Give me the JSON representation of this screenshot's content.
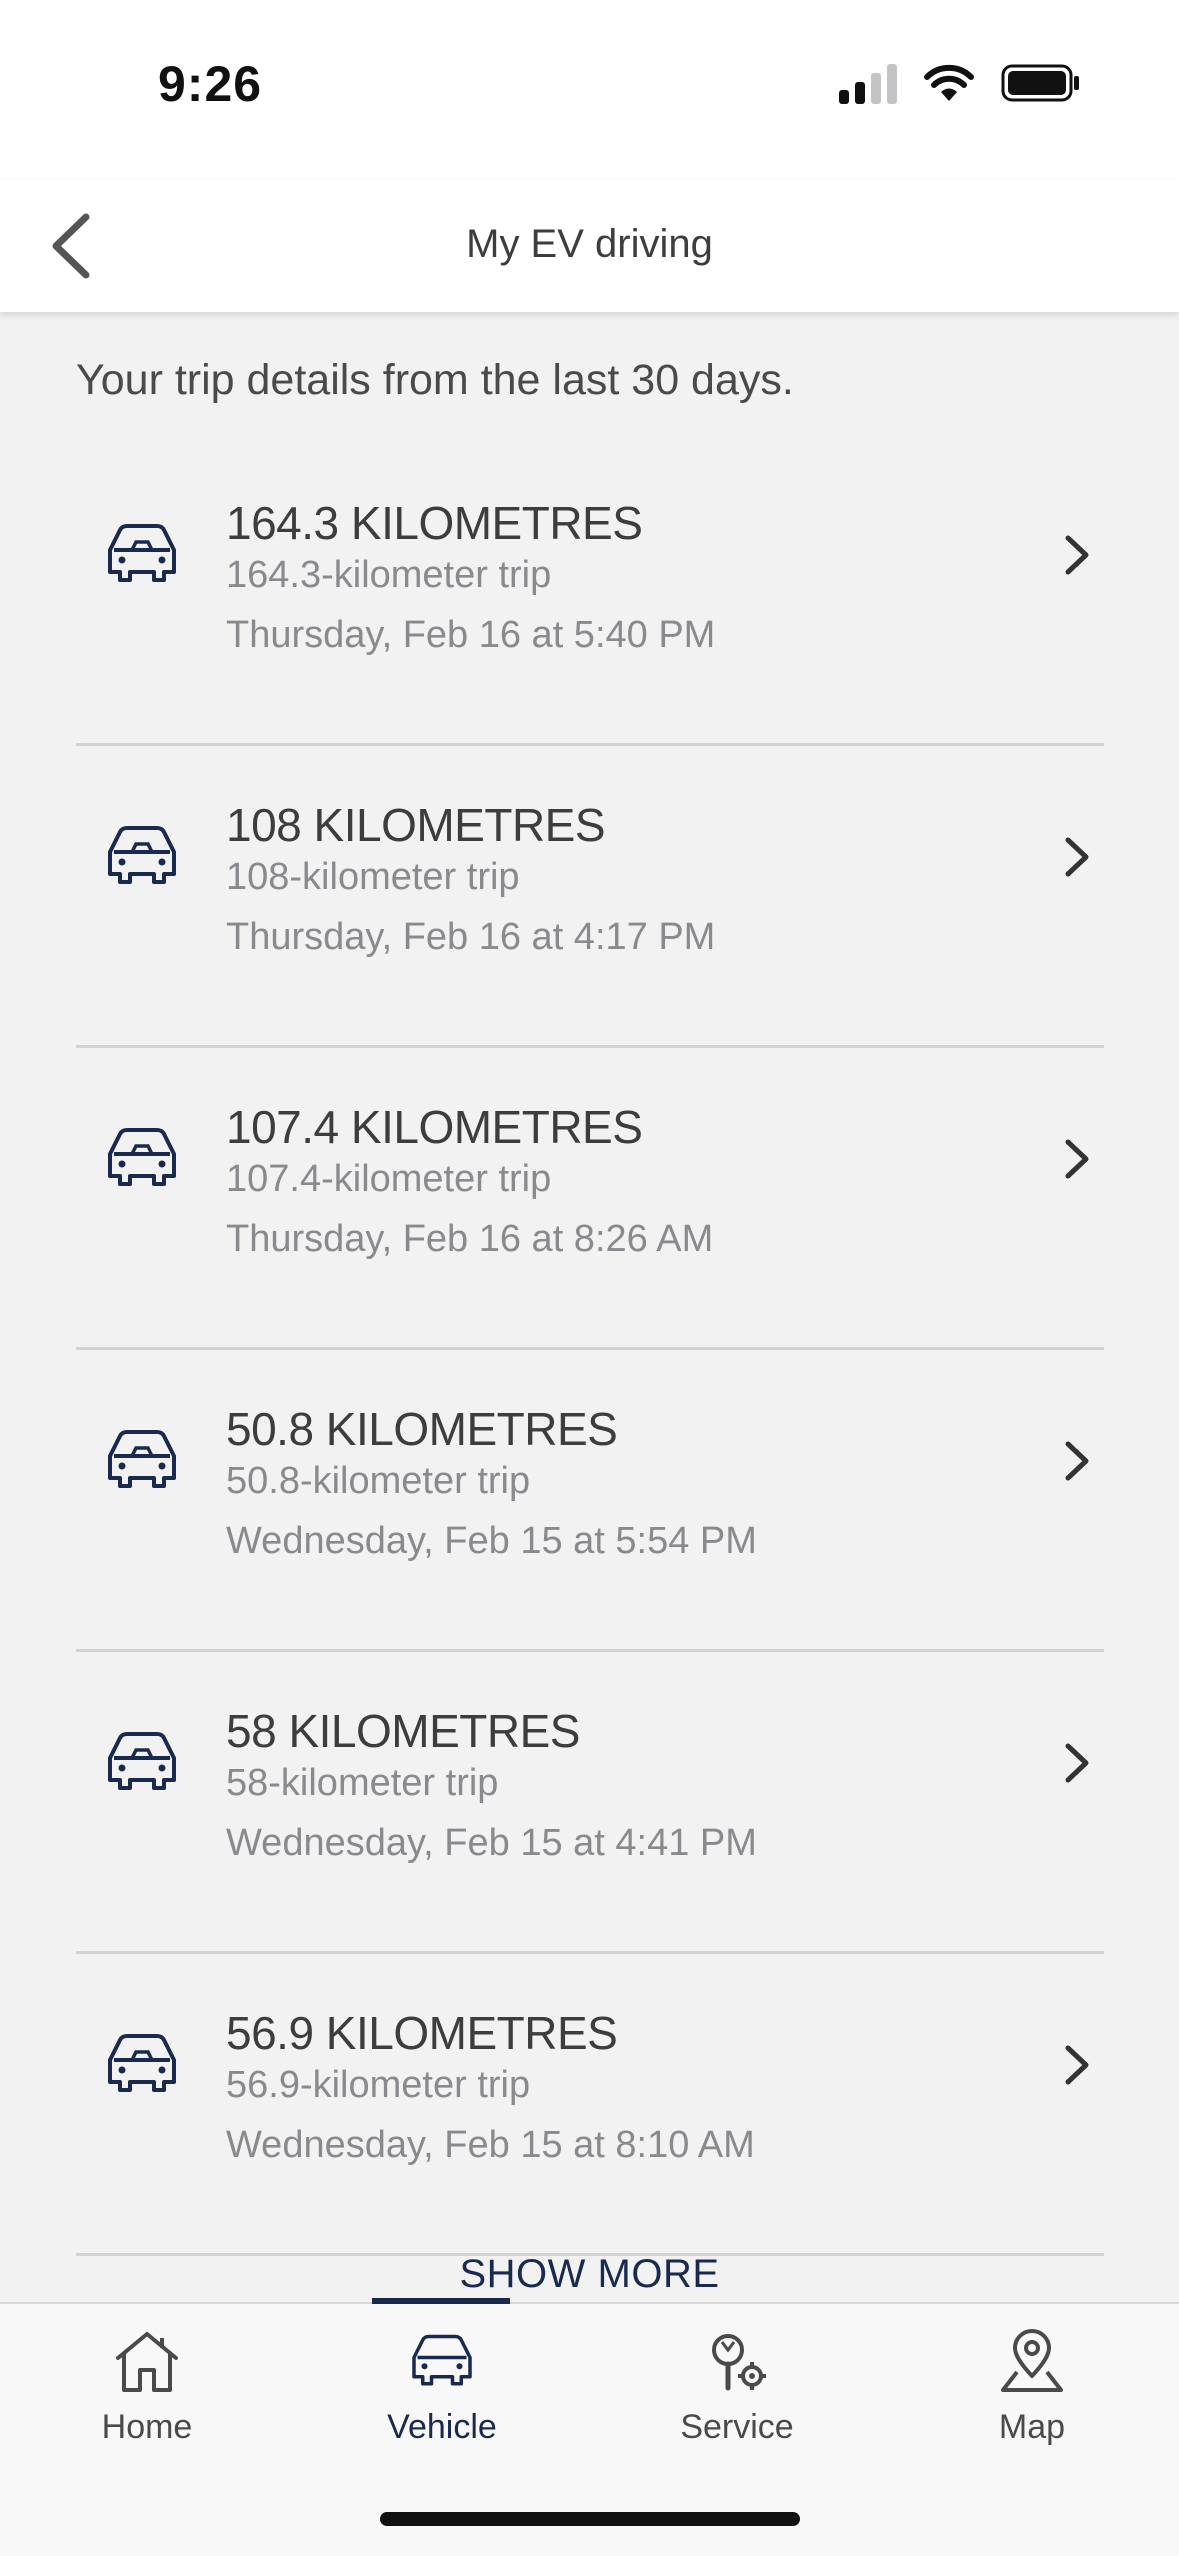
{
  "status_bar": {
    "time": "9:26"
  },
  "header": {
    "title": "My EV driving"
  },
  "intro": "Your trip details from the last 30 days.",
  "trips": [
    {
      "distance": "164.3 KILOMETRES",
      "subtitle": "164.3-kilometer trip",
      "date": "Thursday, Feb 16 at 5:40 PM"
    },
    {
      "distance": "108 KILOMETRES",
      "subtitle": "108-kilometer trip",
      "date": "Thursday, Feb 16 at 4:17 PM"
    },
    {
      "distance": "107.4 KILOMETRES",
      "subtitle": "107.4-kilometer trip",
      "date": "Thursday, Feb 16 at 8:26 AM"
    },
    {
      "distance": "50.8 KILOMETRES",
      "subtitle": "50.8-kilometer trip",
      "date": "Wednesday, Feb 15 at 5:54 PM"
    },
    {
      "distance": "58 KILOMETRES",
      "subtitle": "58-kilometer trip",
      "date": "Wednesday, Feb 15 at 4:41 PM"
    },
    {
      "distance": "56.9 KILOMETRES",
      "subtitle": "56.9-kilometer trip",
      "date": "Wednesday, Feb 15 at 8:10 AM"
    }
  ],
  "show_more_label": "SHOW MORE",
  "tabs": [
    {
      "label": "Home",
      "icon": "home-icon"
    },
    {
      "label": "Vehicle",
      "icon": "car-icon",
      "active": true
    },
    {
      "label": "Service",
      "icon": "service-icon"
    },
    {
      "label": "Map",
      "icon": "map-pin-icon"
    }
  ],
  "colors": {
    "accent": "#1a2a4f",
    "background": "#f2f2f3",
    "text_primary": "#3d3d3f",
    "text_secondary": "#8a8a8e"
  }
}
